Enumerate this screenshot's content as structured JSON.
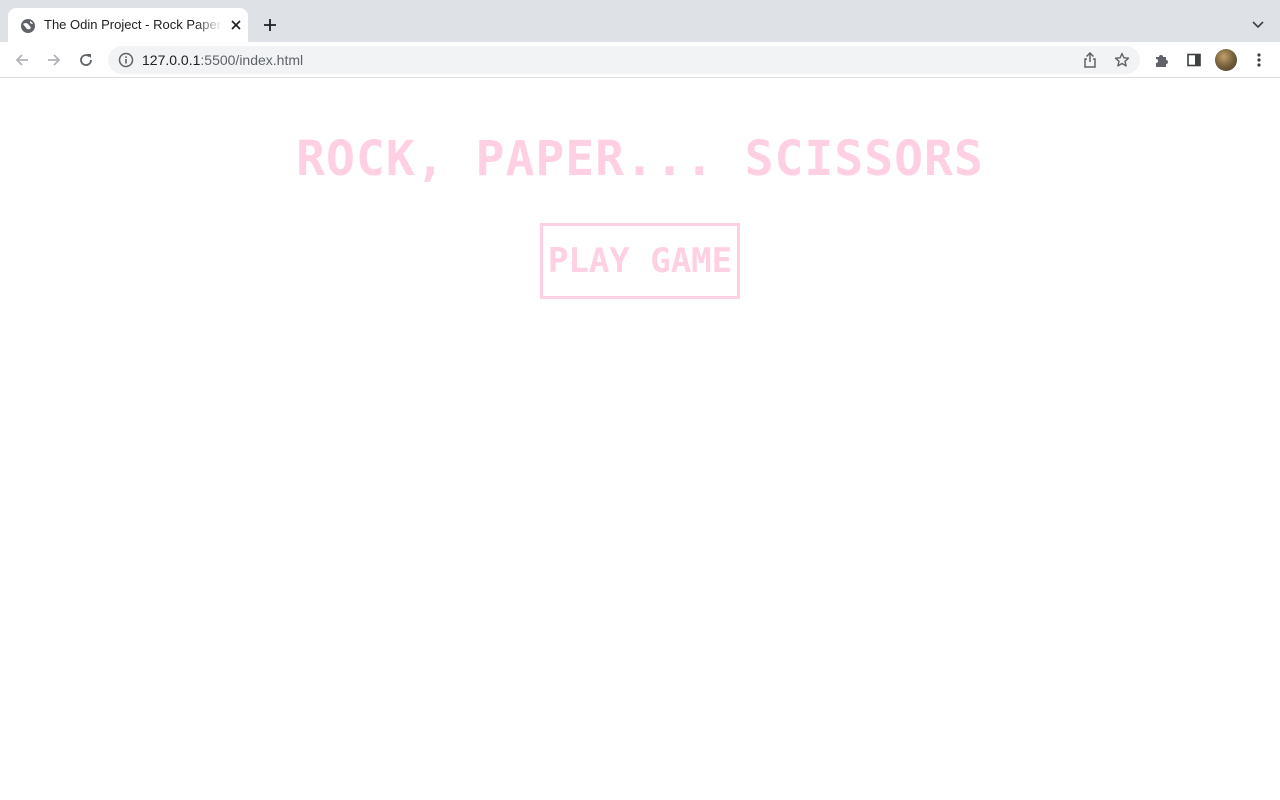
{
  "browser": {
    "tab": {
      "title": "The Odin Project - Rock Paper Scissors",
      "favicon": "globe-icon"
    },
    "address_bar": {
      "host": "127.0.0.1",
      "path": ":5500/index.html"
    },
    "icons": {
      "back": "arrow-left-icon",
      "forward": "arrow-right-icon",
      "reload": "reload-icon",
      "info": "info-icon",
      "share": "share-icon",
      "bookmark": "star-icon",
      "extensions": "puzzle-icon",
      "side_panel": "side-panel-icon",
      "menu": "kebab-menu-icon",
      "new_tab": "plus-icon",
      "tab_search": "chevron-down-icon",
      "close_tab": "close-icon"
    }
  },
  "page": {
    "title": "ROCK, PAPER... SCISSORS",
    "play_button_label": "PLAY GAME",
    "accent_color": "#ffd0e3"
  }
}
